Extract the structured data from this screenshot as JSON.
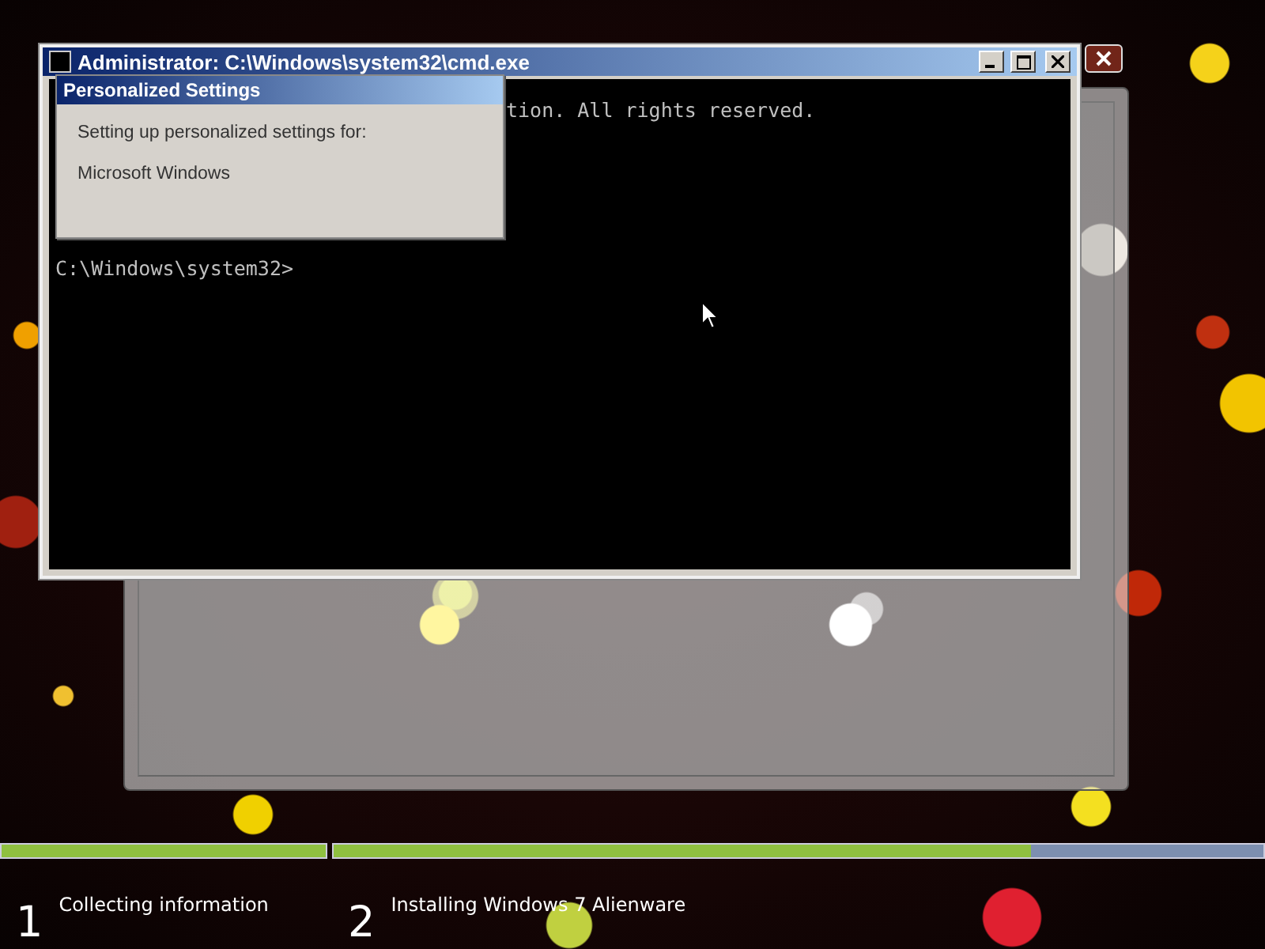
{
  "setup_window": {
    "steps": [
      {
        "number": "1",
        "label": "Collecting information",
        "level": 1
      },
      {
        "number": "2",
        "label": "Installing Windows 7 Alienware",
        "level": 0.75
      }
    ]
  },
  "console_window": {
    "title": "Administrator: C:\\Windows\\system32\\cmd.exe",
    "lines": [
      "tion.  All rights reserved.",
      "C:\\Windows\\system32>"
    ]
  },
  "dialog": {
    "title": "Personalized Settings",
    "message": "Setting up personalized settings for:",
    "item": "Microsoft Windows"
  }
}
